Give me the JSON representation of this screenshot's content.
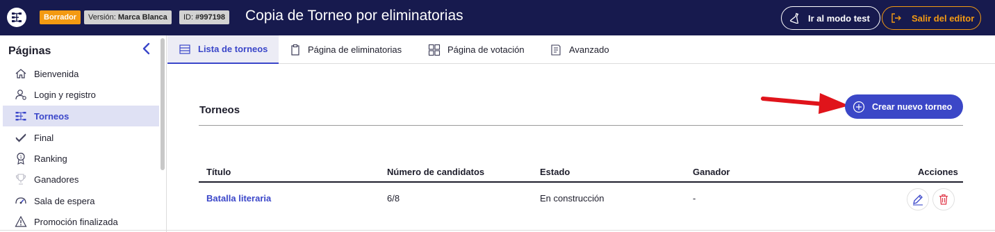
{
  "header": {
    "draft_badge": "Borrador",
    "version_label": "Versión: ",
    "version_value": "Marca Blanca",
    "id_label": "ID: ",
    "id_value": "#997198",
    "title": "Copia de Torneo por eliminatorias",
    "test_mode_label": "Ir al modo test",
    "exit_editor_label": "Salir del editor"
  },
  "sidebar": {
    "title": "Páginas",
    "items": [
      {
        "label": "Bienvenida",
        "icon": "home-icon"
      },
      {
        "label": "Login y registro",
        "icon": "user-icon"
      },
      {
        "label": "Torneos",
        "icon": "bracket-icon",
        "active": true
      },
      {
        "label": "Final",
        "icon": "check-icon"
      },
      {
        "label": "Ranking",
        "icon": "medal-icon"
      },
      {
        "label": "Ganadores",
        "icon": "trophy-icon"
      },
      {
        "label": "Sala de espera",
        "icon": "speedometer-icon"
      },
      {
        "label": "Promoción finalizada",
        "icon": "warning-icon"
      }
    ]
  },
  "tabs": [
    {
      "label": "Lista de torneos",
      "icon": "list-icon",
      "active": true
    },
    {
      "label": "Página de eliminatorias",
      "icon": "clipboard-icon"
    },
    {
      "label": "Página de votación",
      "icon": "grid-icon"
    },
    {
      "label": "Avanzado",
      "icon": "document-icon"
    }
  ],
  "main": {
    "section_title": "Torneos",
    "create_button_label": "Crear nuevo torneo",
    "table": {
      "columns": [
        "Título",
        "Número de candidatos",
        "Estado",
        "Ganador",
        "Acciones"
      ],
      "rows": [
        {
          "title": "Batalla literaria",
          "candidates": "6/8",
          "status": "En construcción",
          "winner": "-"
        }
      ]
    }
  },
  "colors": {
    "header_bg": "#171a4e",
    "accent": "#3b47c7",
    "warning_orange": "#f39a12",
    "delete_red": "#e0394a",
    "annotation_arrow": "#e0141b"
  }
}
